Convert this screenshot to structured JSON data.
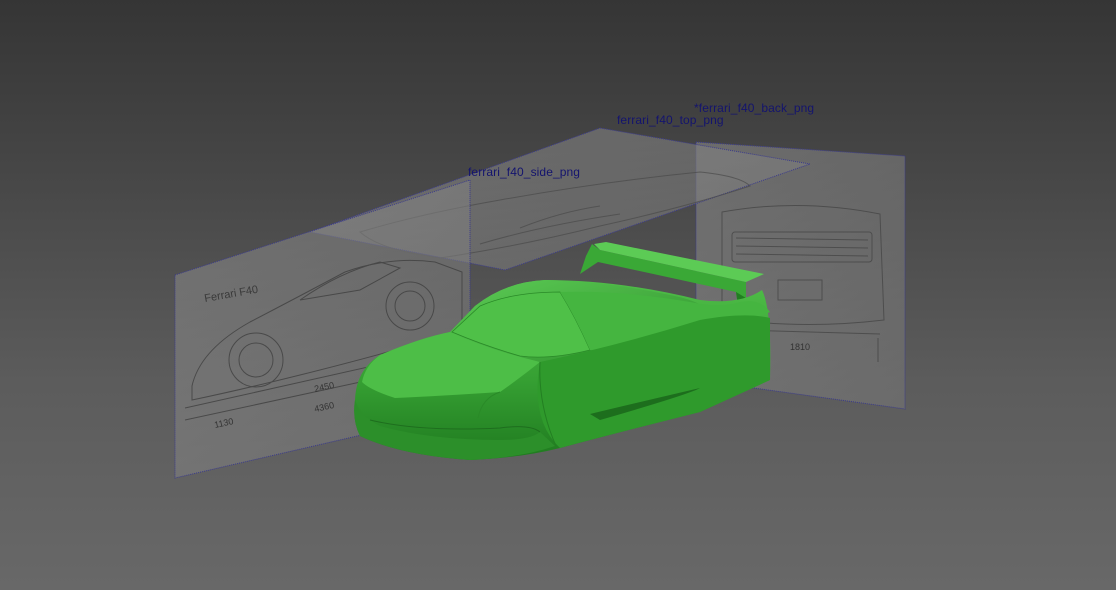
{
  "viewport": {
    "background_top": "#353535",
    "background_bottom": "#686868"
  },
  "image_planes": [
    {
      "id": "side",
      "label": "ferrari_f40_side_png"
    },
    {
      "id": "top",
      "label": "ferrari_f40_top_png"
    },
    {
      "id": "back",
      "label": "*ferrari_f40_back_png"
    }
  ],
  "colors": {
    "plane_wire": "#3a3a8c",
    "label_text": "#14146e",
    "model_body": "#3ca83a",
    "model_shadow": "#1f7a1f",
    "model_highlight": "#58c452",
    "plane_fill": "#8a8a8a"
  },
  "blueprint_texts": {
    "side_title": "Ferrari F40",
    "side_dim_1": "2450",
    "side_dim_2": "4360",
    "side_dim_3": "1130",
    "back_dim": "1810"
  },
  "model": {
    "name": "car body mesh",
    "state": "selected"
  }
}
